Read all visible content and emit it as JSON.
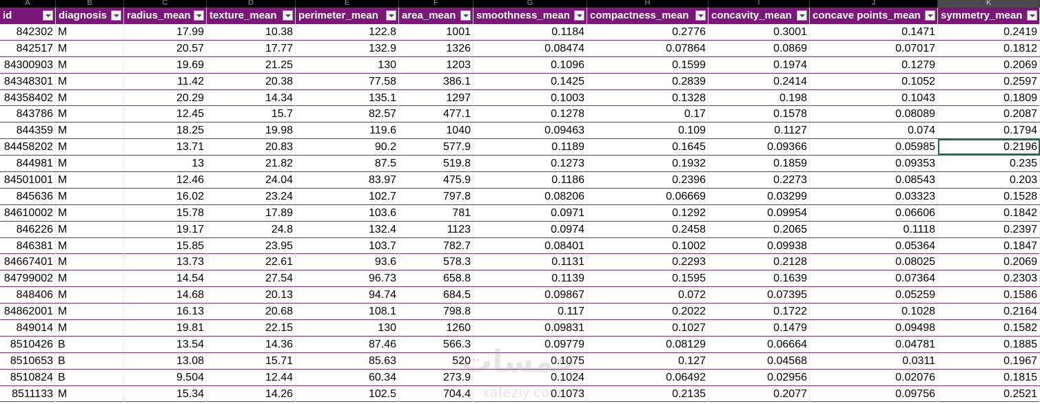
{
  "column_letters": [
    "A",
    "B",
    "C",
    "D",
    "E",
    "F",
    "G",
    "H",
    "I",
    "J",
    "K"
  ],
  "selected_column": 10,
  "headers": [
    "id",
    "diagnosis",
    "radius_mean",
    "texture_mean",
    "perimeter_mean",
    "area_mean",
    "smoothness_mean",
    "compactness_mean",
    "concavity_mean",
    "concave points_mean",
    "symmetry_mean"
  ],
  "rows": [
    [
      "842302",
      "M",
      "17.99",
      "10.38",
      "122.8",
      "1001",
      "0.1184",
      "0.2776",
      "0.3001",
      "0.1471",
      "0.2419"
    ],
    [
      "842517",
      "M",
      "20.57",
      "17.77",
      "132.9",
      "1326",
      "0.08474",
      "0.07864",
      "0.0869",
      "0.07017",
      "0.1812"
    ],
    [
      "84300903",
      "M",
      "19.69",
      "21.25",
      "130",
      "1203",
      "0.1096",
      "0.1599",
      "0.1974",
      "0.1279",
      "0.2069"
    ],
    [
      "84348301",
      "M",
      "11.42",
      "20.38",
      "77.58",
      "386.1",
      "0.1425",
      "0.2839",
      "0.2414",
      "0.1052",
      "0.2597"
    ],
    [
      "84358402",
      "M",
      "20.29",
      "14.34",
      "135.1",
      "1297",
      "0.1003",
      "0.1328",
      "0.198",
      "0.1043",
      "0.1809"
    ],
    [
      "843786",
      "M",
      "12.45",
      "15.7",
      "82.57",
      "477.1",
      "0.1278",
      "0.17",
      "0.1578",
      "0.08089",
      "0.2087"
    ],
    [
      "844359",
      "M",
      "18.25",
      "19.98",
      "119.6",
      "1040",
      "0.09463",
      "0.109",
      "0.1127",
      "0.074",
      "0.1794"
    ],
    [
      "84458202",
      "M",
      "13.71",
      "20.83",
      "90.2",
      "577.9",
      "0.1189",
      "0.1645",
      "0.09366",
      "0.05985",
      "0.2196"
    ],
    [
      "844981",
      "M",
      "13",
      "21.82",
      "87.5",
      "519.8",
      "0.1273",
      "0.1932",
      "0.1859",
      "0.09353",
      "0.235"
    ],
    [
      "84501001",
      "M",
      "12.46",
      "24.04",
      "83.97",
      "475.9",
      "0.1186",
      "0.2396",
      "0.2273",
      "0.08543",
      "0.203"
    ],
    [
      "845636",
      "M",
      "16.02",
      "23.24",
      "102.7",
      "797.8",
      "0.08206",
      "0.06669",
      "0.03299",
      "0.03323",
      "0.1528"
    ],
    [
      "84610002",
      "M",
      "15.78",
      "17.89",
      "103.6",
      "781",
      "0.0971",
      "0.1292",
      "0.09954",
      "0.06606",
      "0.1842"
    ],
    [
      "846226",
      "M",
      "19.17",
      "24.8",
      "132.4",
      "1123",
      "0.0974",
      "0.2458",
      "0.2065",
      "0.1118",
      "0.2397"
    ],
    [
      "846381",
      "M",
      "15.85",
      "23.95",
      "103.7",
      "782.7",
      "0.08401",
      "0.1002",
      "0.09938",
      "0.05364",
      "0.1847"
    ],
    [
      "84667401",
      "M",
      "13.73",
      "22.61",
      "93.6",
      "578.3",
      "0.1131",
      "0.2293",
      "0.2128",
      "0.08025",
      "0.2069"
    ],
    [
      "84799002",
      "M",
      "14.54",
      "27.54",
      "96.73",
      "658.8",
      "0.1139",
      "0.1595",
      "0.1639",
      "0.07364",
      "0.2303"
    ],
    [
      "848406",
      "M",
      "14.68",
      "20.13",
      "94.74",
      "684.5",
      "0.09867",
      "0.072",
      "0.07395",
      "0.05259",
      "0.1586"
    ],
    [
      "84862001",
      "M",
      "16.13",
      "20.68",
      "108.1",
      "798.8",
      "0.117",
      "0.2022",
      "0.1722",
      "0.1028",
      "0.2164"
    ],
    [
      "849014",
      "M",
      "19.81",
      "22.15",
      "130",
      "1260",
      "0.09831",
      "0.1027",
      "0.1479",
      "0.09498",
      "0.1582"
    ],
    [
      "8510426",
      "B",
      "13.54",
      "14.36",
      "87.46",
      "566.3",
      "0.09779",
      "0.08129",
      "0.06664",
      "0.04781",
      "0.1885"
    ],
    [
      "8510653",
      "B",
      "13.08",
      "15.71",
      "85.63",
      "520",
      "0.1075",
      "0.127",
      "0.04568",
      "0.0311",
      "0.1967"
    ],
    [
      "8510824",
      "B",
      "9.504",
      "12.44",
      "60.34",
      "273.9",
      "0.1024",
      "0.06492",
      "0.02956",
      "0.02076",
      "0.1815"
    ],
    [
      "8511133",
      "M",
      "15.34",
      "14.26",
      "102.5",
      "704.4",
      "0.1073",
      "0.2135",
      "0.2077",
      "0.09756",
      "0.2521"
    ]
  ],
  "active_cell": {
    "row": 7,
    "col": 10
  },
  "watermark": {
    "text_main": "خمسات",
    "text_sub": "xafeziy.com"
  },
  "colors": {
    "header_bg": "#7a187a",
    "row_border": "#7a2d7a",
    "active_outline": "#1f7145"
  }
}
